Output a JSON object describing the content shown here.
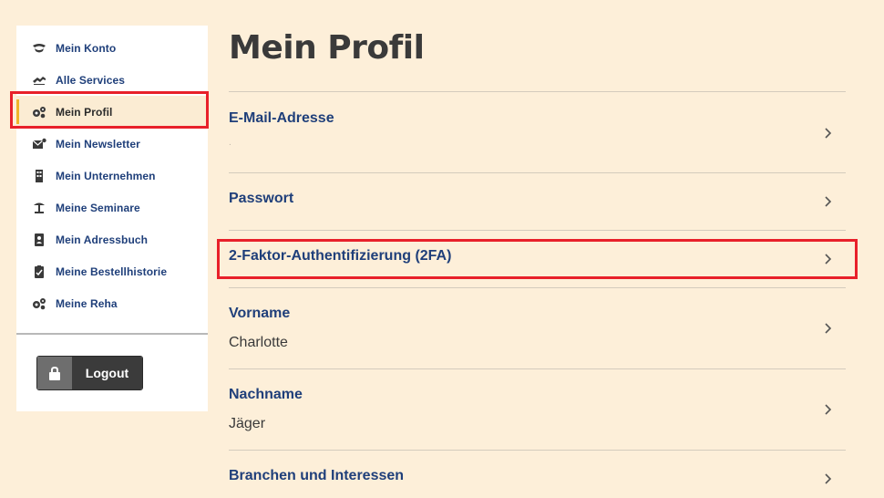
{
  "sidebar": {
    "items": [
      {
        "label": "Mein Konto",
        "icon": "handshake-icon"
      },
      {
        "label": "Alle Services",
        "icon": "services-icon"
      },
      {
        "label": "Mein Profil",
        "icon": "gears-icon",
        "active": true
      },
      {
        "label": "Mein Newsletter",
        "icon": "mail-icon"
      },
      {
        "label": "Mein Unternehmen",
        "icon": "building-icon"
      },
      {
        "label": "Meine Seminare",
        "icon": "lectern-icon"
      },
      {
        "label": "Mein Adressbuch",
        "icon": "address-book-icon"
      },
      {
        "label": "Meine Bestellhistorie",
        "icon": "clipboard-check-icon"
      },
      {
        "label": "Meine Reha",
        "icon": "gears-icon"
      }
    ],
    "logout_label": "Logout"
  },
  "main": {
    "title": "Mein Profil",
    "rows": [
      {
        "label": "E-Mail-Adresse",
        "value": "."
      },
      {
        "label": "Passwort",
        "value": ""
      },
      {
        "label": "2-Faktor-Authentifizierung (2FA)",
        "value": ""
      },
      {
        "label": "Vorname",
        "value": "Charlotte"
      },
      {
        "label": "Nachname",
        "value": "Jäger"
      },
      {
        "label": "Branchen und Interessen",
        "value": ""
      }
    ]
  },
  "colors": {
    "background": "#fdefd9",
    "link_blue": "#1f3f7a",
    "highlight_red": "#e8202a",
    "active_marker": "#f0b429"
  }
}
